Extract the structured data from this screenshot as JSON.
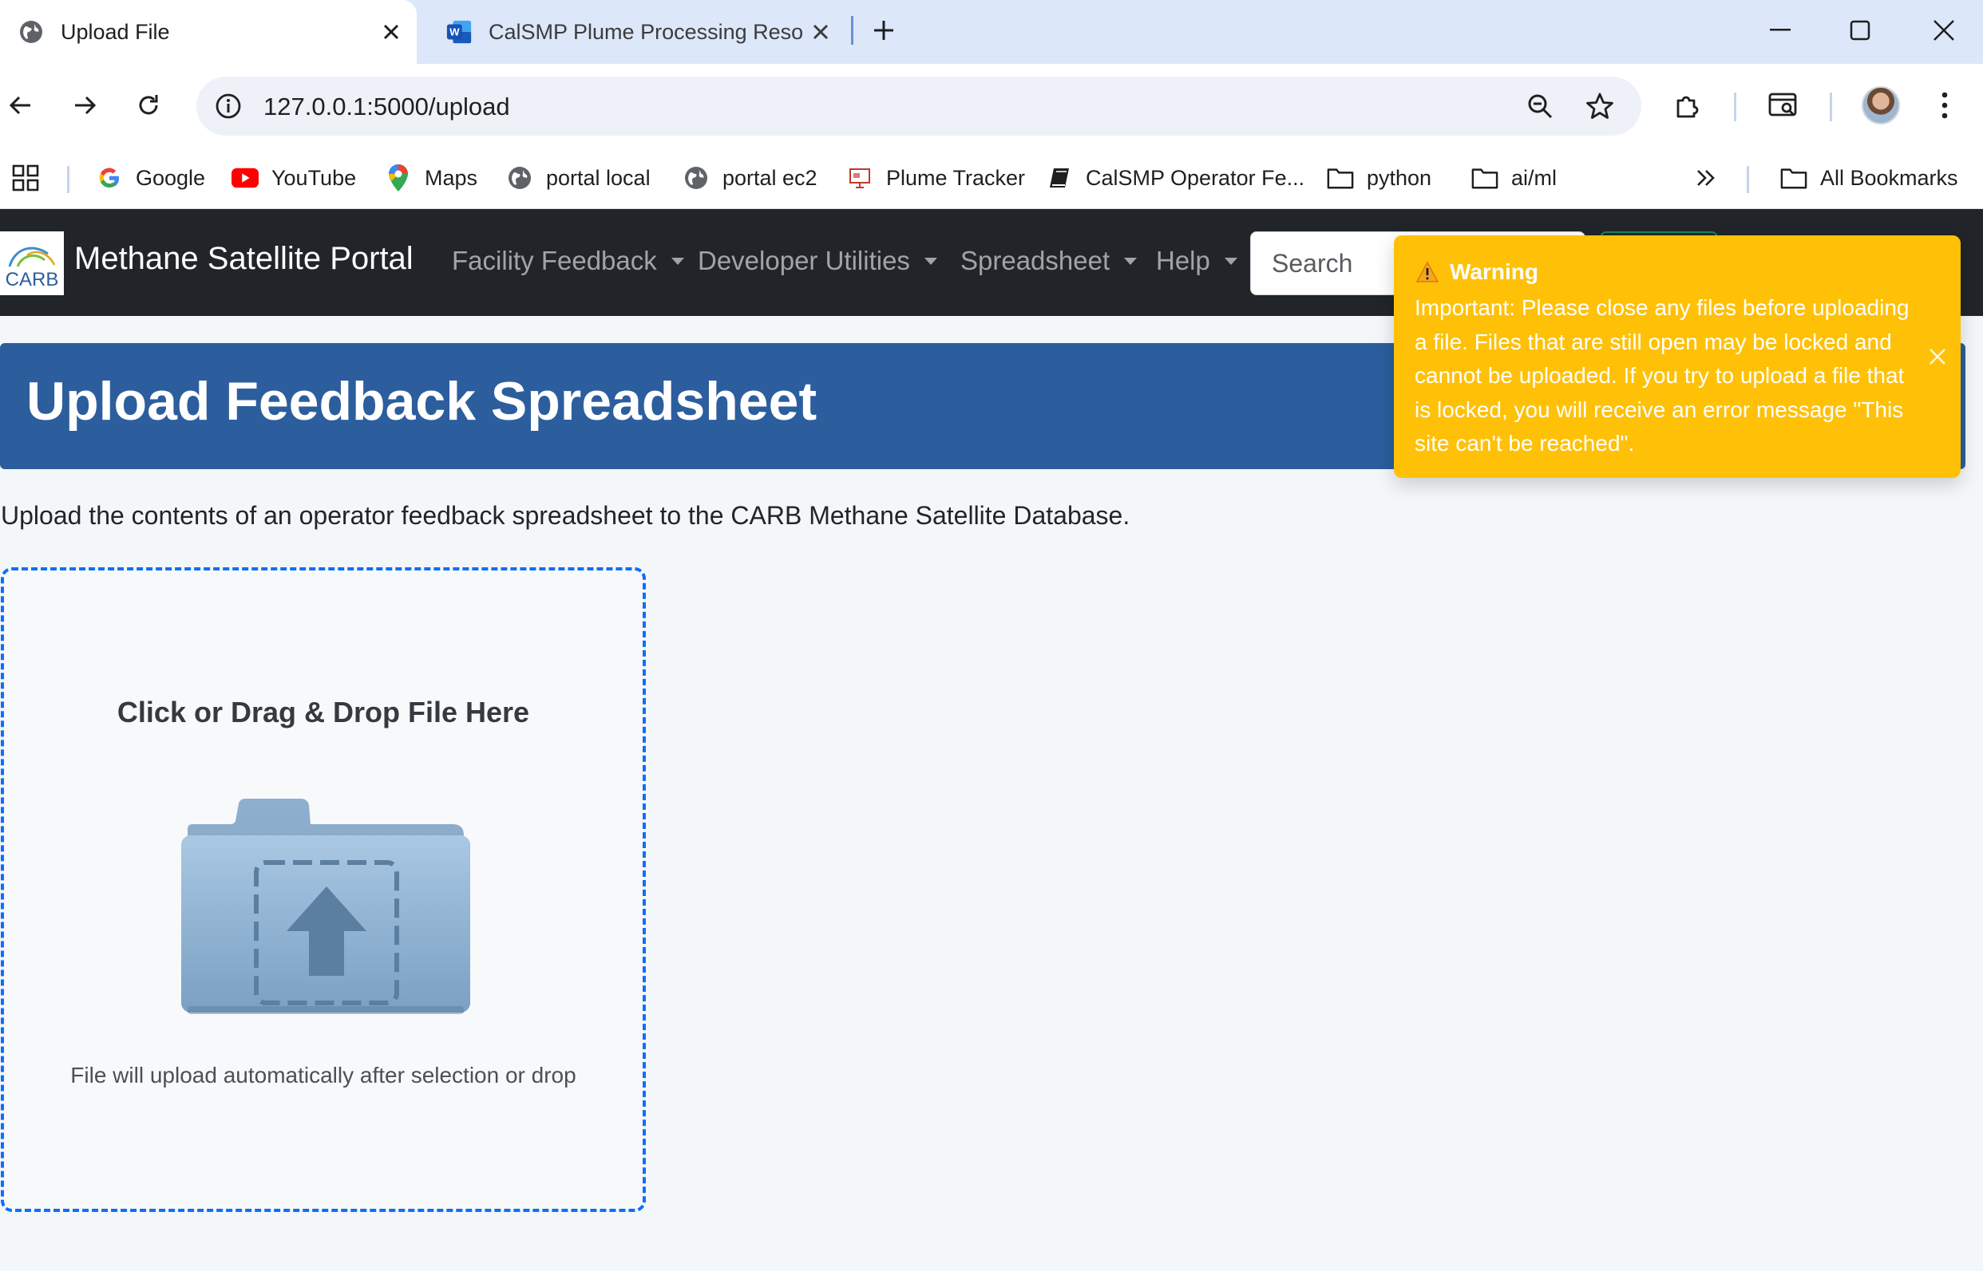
{
  "browser": {
    "tabs": [
      {
        "title": "Upload File",
        "active": true,
        "icon": "globe-icon"
      },
      {
        "title": "CalSMP Plume Processing Reso",
        "active": false,
        "icon": "word-doc-icon"
      }
    ],
    "url": "127.0.0.1:5000/upload",
    "bookmarks": [
      {
        "label": "Google",
        "icon": "google-icon"
      },
      {
        "label": "YouTube",
        "icon": "youtube-icon"
      },
      {
        "label": "Maps",
        "icon": "maps-icon"
      },
      {
        "label": "portal local",
        "icon": "globe-icon"
      },
      {
        "label": "portal ec2",
        "icon": "globe-icon"
      },
      {
        "label": "Plume Tracker",
        "icon": "presentation-icon"
      },
      {
        "label": "CalSMP Operator Fe...",
        "icon": "book-icon"
      },
      {
        "label": "python",
        "icon": "folder-icon"
      },
      {
        "label": "ai/ml",
        "icon": "folder-icon"
      }
    ],
    "all_bookmarks_label": "All Bookmarks"
  },
  "navbar": {
    "logo_text": "CARB",
    "brand": "Methane Satellite Portal",
    "items": [
      {
        "label": "Facility Feedback"
      },
      {
        "label": "Developer Utilities"
      },
      {
        "label": "Spreadsheet"
      },
      {
        "label": "Help"
      }
    ],
    "search_placeholder": "Search"
  },
  "page": {
    "title": "Upload Feedback Spreadsheet",
    "intro": "Upload the contents of an operator feedback spreadsheet to the CARB Methane Satellite Database.",
    "dropzone": {
      "title": "Click or Drag & Drop File Here",
      "hint": "File will upload automatically after selection or drop"
    }
  },
  "toast": {
    "title": "Warning",
    "body": "Important: Please close any files before uploading a file. Files that are still open may be locked and cannot be uploaded. If you try to upload a file that is locked, you will receive an error message \"This site can't be reached\".",
    "color": "#ffc107"
  },
  "colors": {
    "navbar_bg": "#212529",
    "header_bg": "#2c5e9e",
    "dropzone_border": "#0d6efd",
    "page_bg": "#f4f7fa"
  }
}
